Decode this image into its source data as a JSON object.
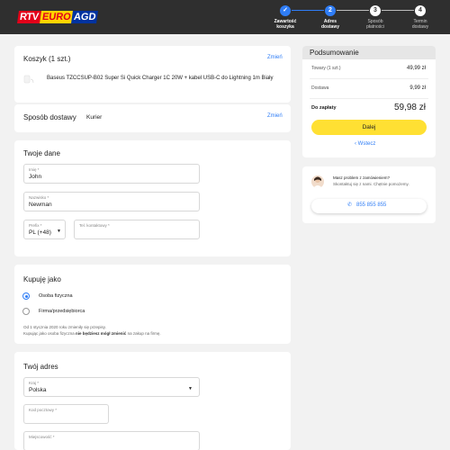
{
  "brand": {
    "rtv": "RTV",
    "euro": "EURO",
    "agd": "AGD"
  },
  "steps": [
    {
      "num": "✓",
      "label_line1": "Zawartość",
      "label_line2": "koszyka",
      "state": "done"
    },
    {
      "num": "2",
      "label_line1": "Adres",
      "label_line2": "dostawy",
      "state": "active"
    },
    {
      "num": "3",
      "label_line1": "Sposób",
      "label_line2": "płatności",
      "state": "todo"
    },
    {
      "num": "4",
      "label_line1": "Termin",
      "label_line2": "dostawy",
      "state": "todo"
    }
  ],
  "cart": {
    "title": "Koszyk (1 szt.)",
    "change": "Zmień",
    "product": "Baseus TZCCSUP-B02 Super Si Quick Charger 1C 20W + kabel USB-C do Lightning 1m Biały"
  },
  "shipping": {
    "title": "Sposób dostawy",
    "method": "Kurier",
    "change": "Zmień"
  },
  "your_data": {
    "title": "Twoje dane",
    "first_name_label": "Imię *",
    "first_name": "John",
    "last_name_label": "Nazwisko *",
    "last_name": "Newman",
    "prefix_label": "Prefix *",
    "prefix": "PL (+48)",
    "phone_label": "Tel. kontaktowy *"
  },
  "buy_as": {
    "title": "Kupuję jako",
    "option1": "Osoba fizyczna",
    "option2": "Firma/przedsiębiorca",
    "note1": "Od 1 stycznia 2020 roku zmieniły się przepisy.",
    "note2_a": "Kupując jako osoba fizyczna ",
    "note2_b": "nie będziesz mógł zmienić",
    "note2_c": " na zakup na firmę."
  },
  "address": {
    "title": "Twój adres",
    "country_label": "Kraj *",
    "country": "Polska",
    "postal_label": "Kod pocztowy *",
    "city_label": "Miejscowość *"
  },
  "summary": {
    "title": "Podsumowanie",
    "goods_label": "Towary (1 szt.)",
    "goods_value": "49,99 zł",
    "delivery_label": "Dostawa",
    "delivery_value": "9,99 zł",
    "total_label": "Do zapłaty",
    "total_value": "59,98 zł",
    "next_button": "Dalej",
    "back_link": "Wstecz"
  },
  "help": {
    "title": "Masz problem z zamówieniem?",
    "subtitle": "Skontaktuj się z nami. Chętnie pomożemy.",
    "phone": "855 855 855"
  },
  "colors": {
    "accent": "#2f7df6",
    "button_yellow": "#ffe033",
    "topbar": "#2f2f2f"
  }
}
